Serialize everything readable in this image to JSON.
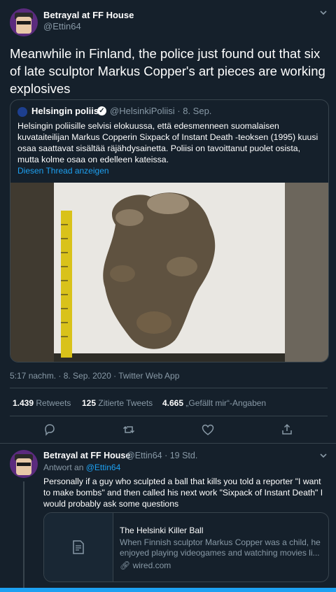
{
  "main_tweet": {
    "author_name": "Betrayal at FF House",
    "author_handle": "@Ettin64",
    "text": "Meanwhile in Finland, the police just found out that six of late sculptor Markus Copper's art pieces are working explosives",
    "timestamp": "5:17 nachm. · 8. Sep. 2020 · Twitter Web App"
  },
  "quote": {
    "author_name": "Helsingin poliisi",
    "author_handle": "@HelsinkiPoliisi · 8. Sep.",
    "text": "Helsingin poliisille selvisi elokuussa, että edesmenneen suomalaisen kuvataiteilijan Markus Copperin Sixpack of Instant Death -teoksen (1995) kuusi osaa saattavat sisältää räjähdysainetta. Poliisi on tavoittanut puolet osista, mutta kolme osaa on edelleen kateissa.",
    "thread_link": "Diesen Thread anzeigen"
  },
  "stats": {
    "retweets_count": "1.439",
    "retweets_label": "Retweets",
    "quotes_count": "125",
    "quotes_label": "Zitierte Tweets",
    "likes_count": "4.665",
    "likes_label": "„Gefällt mir“-Angaben"
  },
  "reply": {
    "author_name": "Betrayal at FF House",
    "author_handle_time": "@Ettin64 · 19 Std.",
    "reply_to_prefix": "Antwort an",
    "reply_to_mention": "@Ettin64",
    "text": "Personally if a guy who sculpted a ball that kills you told a reporter \"I want to make bombs\" and then called his next work \"Sixpack of Instant Death\" I would probably ask some questions"
  },
  "card": {
    "title": "The Helsinki Killer Ball",
    "description": "When Finnish sculptor Markus Copper was a child, he enjoyed playing videogames and watching movies li...",
    "url": "wired.com"
  },
  "colors": {
    "background": "#15202b",
    "accent": "#1da1f2",
    "muted": "#8899a6",
    "border": "#38444d"
  },
  "icons": [
    "chevron-down-icon",
    "verified-icon",
    "reply-icon",
    "retweet-icon",
    "like-icon",
    "share-icon",
    "document-icon",
    "link-icon"
  ]
}
